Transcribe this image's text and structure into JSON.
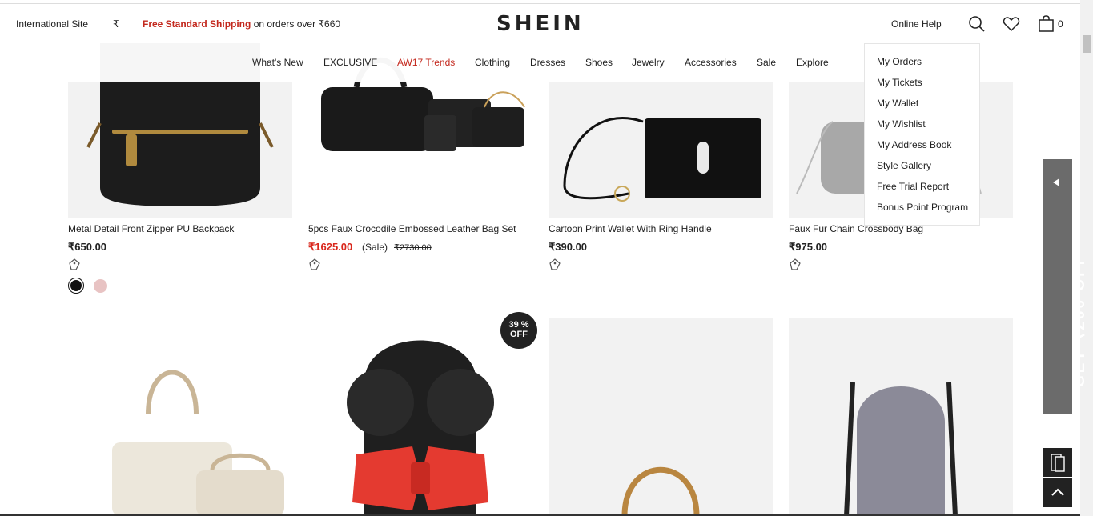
{
  "topbar": {
    "site_label": "International Site",
    "currency": "₹",
    "shipping_bold": "Free Standard Shipping",
    "shipping_rest": " on orders over ₹660",
    "logo": "SHEIN",
    "online_help": "Online Help",
    "cart_count": "0"
  },
  "nav": {
    "items": [
      "What's New",
      "EXCLUSIVE",
      "AW17 Trends",
      "Clothing",
      "Dresses",
      "Shoes",
      "Jewelry",
      "Accessories",
      "Sale",
      "Explore"
    ]
  },
  "dropdown": {
    "items": [
      "My Orders",
      "My Tickets",
      "My Wallet",
      "My Wishlist",
      "My Address Book",
      "Style Gallery",
      "Free Trial Report",
      "Bonus Point Program"
    ]
  },
  "products": [
    {
      "name": "Metal Detail Front Zipper PU Backpack",
      "price": "₹650.00"
    },
    {
      "name": "5pcs Faux Crocodile Embossed Leather Bag Set",
      "price": "₹1625.00",
      "sale_label": "(Sale)",
      "old_price": "₹2730.00"
    },
    {
      "name": "Cartoon Print Wallet With Ring Handle",
      "price": "₹390.00"
    },
    {
      "name": "Faux Fur Chain Crossbody Bag",
      "price": "₹975.00"
    }
  ],
  "badge": {
    "line1": "39 %",
    "line2": "OFF"
  },
  "promo": {
    "text": "GET ₹200 OFF"
  },
  "icons": [
    "search-icon",
    "heart-icon",
    "cart-icon",
    "tag-icon",
    "mobile-icon",
    "chevron-up-icon",
    "triangle-left-icon"
  ],
  "colors": {
    "accent": "#c3281d",
    "sale_price": "#d9281d",
    "promo_bg": "#6b6b6b",
    "dark": "#222222"
  }
}
